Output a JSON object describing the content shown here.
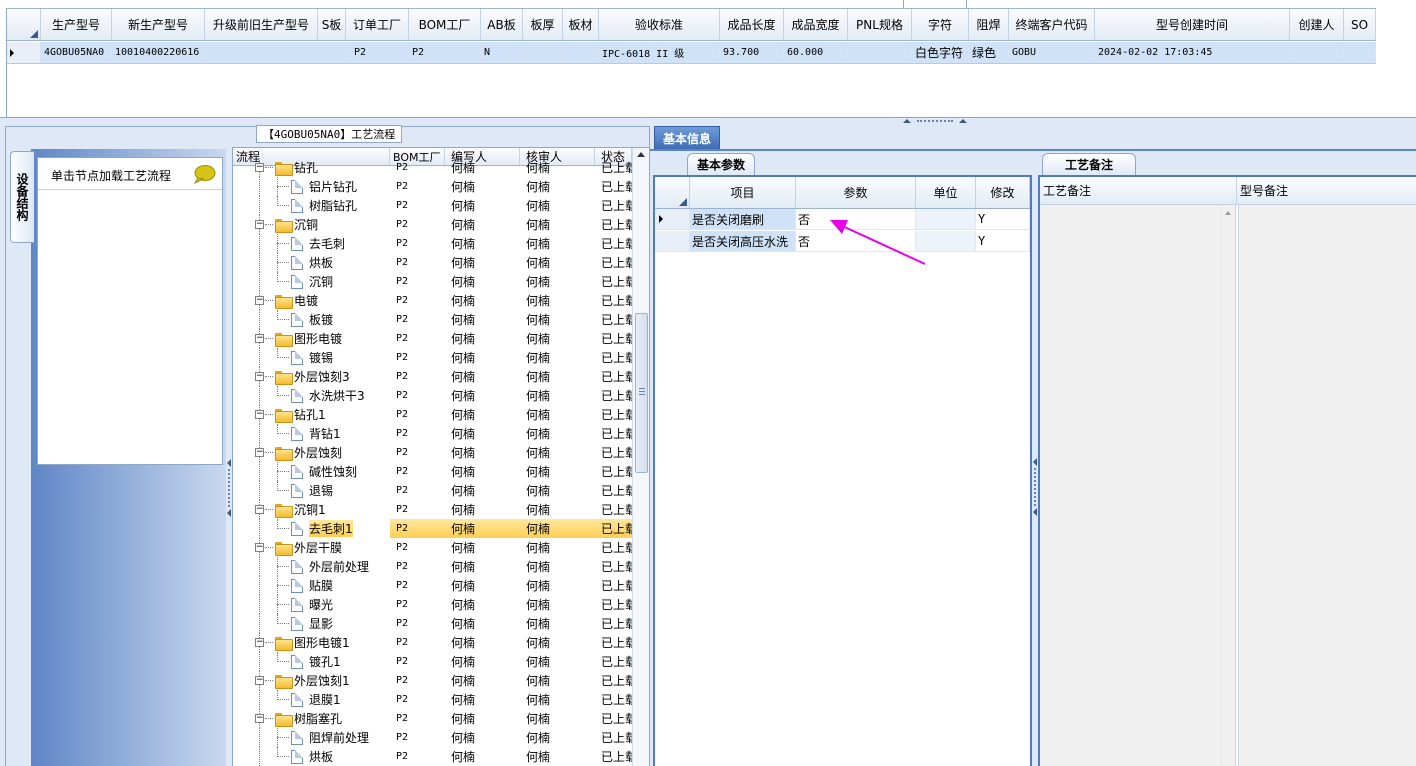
{
  "top_grid": {
    "columns": [
      "生产型号",
      "新生产型号",
      "升级前旧生产型号",
      "S板",
      "订单工厂",
      "BOM工厂",
      "AB板",
      "板厚",
      "板材",
      "验收标准",
      "成品长度",
      "成品宽度",
      "PNL规格",
      "字符",
      "阻焊",
      "终端客户代码",
      "型号创建时间",
      "创建人",
      "SO"
    ],
    "row": {
      "prod_model": "4GOBU05NA0",
      "new_model": "10010400220616",
      "old_model": "",
      "s_board": "",
      "order_factory": "P2",
      "bom_factory": "P2",
      "ab_board": "N",
      "thickness": "",
      "material": "",
      "standard": "IPC-6018 II 级",
      "length": "93.700",
      "width": "60.000",
      "pnl": "",
      "char": "白色字符",
      "mask": "绿色",
      "customer": "GOBU",
      "created": "2024-02-02 17:03:45",
      "creator": "",
      "so": ""
    }
  },
  "left_panel": {
    "title": "【4GOBU05NA0】工艺流程",
    "vertical_tab": "设备结构",
    "nav_hint": "单击节点加载工艺流程"
  },
  "tree": {
    "columns": [
      "流程",
      "BOM工厂",
      "编写人",
      "核审人",
      "状态"
    ],
    "rows": [
      {
        "level": 0,
        "name": "钻孔",
        "bom": "P2",
        "writer": "何楠",
        "reviewer": "何楠",
        "status": "已上载"
      },
      {
        "level": 1,
        "name": "铝片钻孔",
        "bom": "P2",
        "writer": "何楠",
        "reviewer": "何楠",
        "status": "已上载"
      },
      {
        "level": 1,
        "name": "树脂钻孔",
        "bom": "P2",
        "writer": "何楠",
        "reviewer": "何楠",
        "status": "已上载"
      },
      {
        "level": 0,
        "name": "沉铜",
        "bom": "P2",
        "writer": "何楠",
        "reviewer": "何楠",
        "status": "已上载"
      },
      {
        "level": 1,
        "name": "去毛刺",
        "bom": "P2",
        "writer": "何楠",
        "reviewer": "何楠",
        "status": "已上载"
      },
      {
        "level": 1,
        "name": "烘板",
        "bom": "P2",
        "writer": "何楠",
        "reviewer": "何楠",
        "status": "已上载"
      },
      {
        "level": 1,
        "name": "沉铜",
        "bom": "P2",
        "writer": "何楠",
        "reviewer": "何楠",
        "status": "已上载"
      },
      {
        "level": 0,
        "name": "电镀",
        "bom": "P2",
        "writer": "何楠",
        "reviewer": "何楠",
        "status": "已上载"
      },
      {
        "level": 1,
        "name": "板镀",
        "bom": "P2",
        "writer": "何楠",
        "reviewer": "何楠",
        "status": "已上载"
      },
      {
        "level": 0,
        "name": "图形电镀",
        "bom": "P2",
        "writer": "何楠",
        "reviewer": "何楠",
        "status": "已上载"
      },
      {
        "level": 1,
        "name": "镀锡",
        "bom": "P2",
        "writer": "何楠",
        "reviewer": "何楠",
        "status": "已上载"
      },
      {
        "level": 0,
        "name": "外层蚀刻3",
        "bom": "P2",
        "writer": "何楠",
        "reviewer": "何楠",
        "status": "已上载"
      },
      {
        "level": 1,
        "name": "水洗烘干3",
        "bom": "P2",
        "writer": "何楠",
        "reviewer": "何楠",
        "status": "已上载"
      },
      {
        "level": 0,
        "name": "钻孔1",
        "bom": "P2",
        "writer": "何楠",
        "reviewer": "何楠",
        "status": "已上载"
      },
      {
        "level": 1,
        "name": "背钻1",
        "bom": "P2",
        "writer": "何楠",
        "reviewer": "何楠",
        "status": "已上载"
      },
      {
        "level": 0,
        "name": "外层蚀刻",
        "bom": "P2",
        "writer": "何楠",
        "reviewer": "何楠",
        "status": "已上载"
      },
      {
        "level": 1,
        "name": "碱性蚀刻",
        "bom": "P2",
        "writer": "何楠",
        "reviewer": "何楠",
        "status": "已上载"
      },
      {
        "level": 1,
        "name": "退锡",
        "bom": "P2",
        "writer": "何楠",
        "reviewer": "何楠",
        "status": "已上载"
      },
      {
        "level": 0,
        "name": "沉铜1",
        "bom": "P2",
        "writer": "何楠",
        "reviewer": "何楠",
        "status": "已上载"
      },
      {
        "level": 1,
        "name": "去毛刺1",
        "bom": "P2",
        "writer": "何楠",
        "reviewer": "何楠",
        "status": "已上载",
        "selected": true
      },
      {
        "level": 0,
        "name": "外层干膜",
        "bom": "P2",
        "writer": "何楠",
        "reviewer": "何楠",
        "status": "已上载"
      },
      {
        "level": 1,
        "name": "外层前处理",
        "bom": "P2",
        "writer": "何楠",
        "reviewer": "何楠",
        "status": "已上载"
      },
      {
        "level": 1,
        "name": "贴膜",
        "bom": "P2",
        "writer": "何楠",
        "reviewer": "何楠",
        "status": "已上载"
      },
      {
        "level": 1,
        "name": "曝光",
        "bom": "P2",
        "writer": "何楠",
        "reviewer": "何楠",
        "status": "已上载"
      },
      {
        "level": 1,
        "name": "显影",
        "bom": "P2",
        "writer": "何楠",
        "reviewer": "何楠",
        "status": "已上载"
      },
      {
        "level": 0,
        "name": "图形电镀1",
        "bom": "P2",
        "writer": "何楠",
        "reviewer": "何楠",
        "status": "已上载"
      },
      {
        "level": 1,
        "name": "镀孔1",
        "bom": "P2",
        "writer": "何楠",
        "reviewer": "何楠",
        "status": "已上载"
      },
      {
        "level": 0,
        "name": "外层蚀刻1",
        "bom": "P2",
        "writer": "何楠",
        "reviewer": "何楠",
        "status": "已上载"
      },
      {
        "level": 1,
        "name": "退膜1",
        "bom": "P2",
        "writer": "何楠",
        "reviewer": "何楠",
        "status": "已上载"
      },
      {
        "level": 0,
        "name": "树脂塞孔",
        "bom": "P2",
        "writer": "何楠",
        "reviewer": "何楠",
        "status": "已上载"
      },
      {
        "level": 1,
        "name": "阻焊前处理",
        "bom": "P2",
        "writer": "何楠",
        "reviewer": "何楠",
        "status": "已上载"
      },
      {
        "level": 1,
        "name": "烘板",
        "bom": "P2",
        "writer": "何楠",
        "reviewer": "何楠",
        "status": "已上载"
      }
    ]
  },
  "right": {
    "main_tab": "基本信息",
    "param_tab": "基本参数",
    "param_columns": [
      "项目",
      "参数",
      "单位",
      "修改"
    ],
    "params": [
      {
        "item": "是否关闭磨刷",
        "value": "否",
        "unit": "",
        "modify": "Y"
      },
      {
        "item": "是否关闭高压水洗",
        "value": "否",
        "unit": "",
        "modify": "Y"
      }
    ],
    "remark_tab": "工艺备注",
    "remark_columns": [
      "工艺备注",
      "型号备注"
    ]
  },
  "colors": {
    "selected_row": "#ffcf55",
    "accent_blue": "#4f7bbf",
    "arrow": "#e800e8"
  }
}
